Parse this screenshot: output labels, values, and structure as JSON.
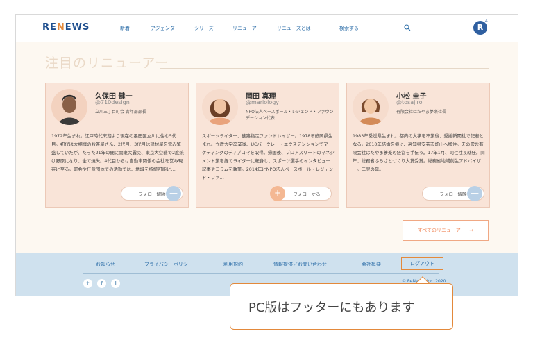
{
  "header": {
    "logo": {
      "a": "RE",
      "b": "N",
      "c": "EWS"
    },
    "nav": [
      "新着",
      "アジェンダ",
      "シリーズ",
      "リニューアー",
      "リニューズとは",
      "検索する"
    ],
    "badge": "4"
  },
  "section": {
    "title": "注目のリニューアー"
  },
  "cards": [
    {
      "name": "久保田 健一",
      "handle": "@710design",
      "role": "立川三丁目町会 青年部部長",
      "bio": "1972年生まれ。江戸時代末期より現在の墨田区立川に住む5代目。初代は大相撲のお茶屋さん、2代目、3代目は建材屋を営み繁盛していたが、たった21年の間に関東大震災、東京大空襲で2度焼け野原になり、全て焼失。4代目からは自動車関係の会社を営み現在に至る。町会や任意団体での活動では、地域を持続可能に…",
      "button": "フォロー解除",
      "circle": "—"
    },
    {
      "name": "岡田 真理",
      "handle": "@mariology",
      "role": "NPO法人ベースボール・レジェンド・ファウンデーション代表",
      "bio": "スポーツライター、進路指定ファンドレイザー。1978年静岡県生まれ。立教大学卒業後、UCバークレー・エクステンションでマーケティングのディプロマを取得。帰国後、プロアスリートのマネジメント業を経てライターに転身し、スポーツ選手のインタビュー記事やコラムを執筆。2014年にNPO法人ベースボール・レジェンド・ファ…",
      "button": "フォローする",
      "circle": "+"
    },
    {
      "name": "小松 圭子",
      "handle": "@tosajiro",
      "role": "有限会社はたやま夢楽社長",
      "bio": "1983年愛媛県生まれ。都内の大学を卒業後、愛媛新聞社で記者となる。2010年結婚を機に、高知県安芸市畑山へ移住。夫の営む有限会社はたやま夢楽の経営を手伝う。17年1月、同社社長就任。同年、総務省ふるさとづくり大賞受賞。総務省地域創生アドバイザー。二児の母。",
      "button": "フォロー解除",
      "circle": "—"
    }
  ],
  "all_button": {
    "label": "すべてのリニューアー",
    "arrow": "→"
  },
  "footer": {
    "links": [
      "お知らせ",
      "プライバシーポリシー",
      "利用規約",
      "情報提供／お問い合わせ",
      "会社概要"
    ],
    "logout": "ログアウト",
    "social": [
      "t",
      "f",
      "i"
    ],
    "copyright": "© ReNews, Inc. 2020"
  },
  "callout": {
    "text": "PC版はフッターにもあります"
  },
  "colors": {
    "accent": "#e3893b",
    "brand": "#1f4f8f",
    "card_bg": "#f9e4d8",
    "footer_bg": "#cfe1ee"
  }
}
